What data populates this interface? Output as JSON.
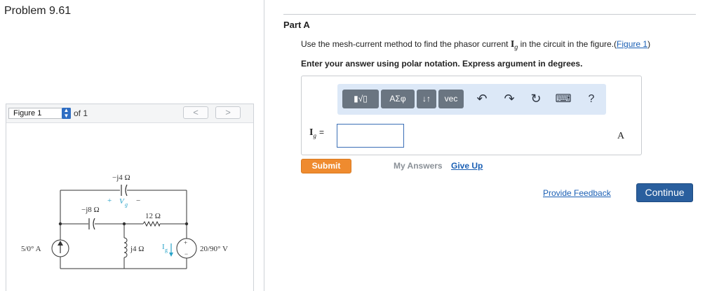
{
  "problem": {
    "title": "Problem 9.61"
  },
  "figure_panel": {
    "selected": "Figure 1",
    "of_text": "of 1",
    "prev_symbol": "<",
    "next_symbol": ">"
  },
  "circuit": {
    "label_top_cap": "−j4 Ω",
    "label_vg_plus": "+",
    "label_vg": "V",
    "label_vg_sub": "g",
    "label_vg_minus": "−",
    "label_left_cap": "−j8 Ω",
    "label_resistor": "12 Ω",
    "label_source_current": "5/0° A",
    "label_inductor": "j4 Ω",
    "label_ig": "I",
    "label_ig_sub": "g",
    "label_source_voltage": "20/90° V",
    "label_vsrc_plus": "+",
    "label_vsrc_minus": "−"
  },
  "part": {
    "label": "Part A",
    "question_pre": "Use the mesh-current method to find the phasor current ",
    "question_symbol": "I",
    "question_symbol_sub": "g",
    "question_post": " in the circuit in the figure.(",
    "figure_link": "Figure 1",
    "question_close": ")",
    "instruction": "Enter your answer using polar notation. Express argument in degrees."
  },
  "toolbar": {
    "templates_label": "▮√▯",
    "greek_label": "ΑΣφ",
    "updown_label": "↓↑",
    "vec_label": "vec",
    "undo_icon": "↶",
    "redo_icon": "↷",
    "reset_icon": "↻",
    "keyboard_icon": "⌨",
    "help_label": "?"
  },
  "answer": {
    "var_label": "I",
    "var_sub": "g",
    "equals": "=",
    "value": "",
    "unit": "A"
  },
  "actions": {
    "submit_label": "Submit",
    "my_answers_label": "My Answers",
    "give_up_label": "Give Up",
    "feedback_label": "Provide Feedback",
    "continue_label": "Continue"
  },
  "colors": {
    "accent_blue": "#2a5f9e",
    "link_blue": "#1a5fb4",
    "submit_orange": "#ef8b2f",
    "current_arrow": "#2aa4c9"
  }
}
